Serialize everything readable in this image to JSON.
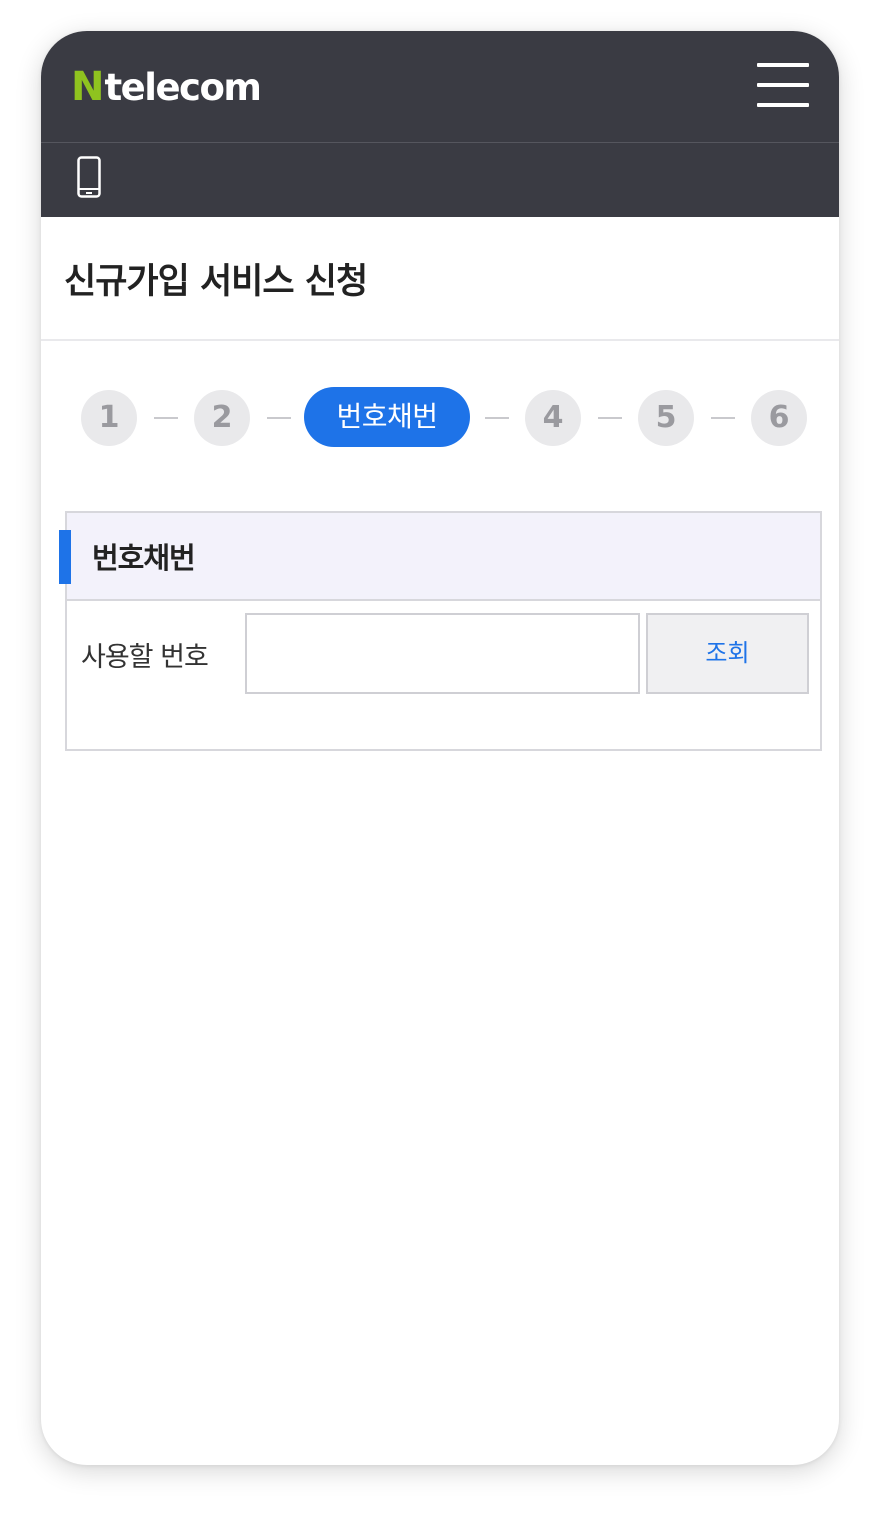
{
  "header": {
    "logo_letter": "N",
    "logo_text": "telecom",
    "menu_icon": "hamburger-menu-icon",
    "logo_color": "#8fc31f",
    "bar_color": "#3a3b43"
  },
  "subheader": {
    "icon": "mobile-phone-icon"
  },
  "page": {
    "title": "신규가입 서비스 신청"
  },
  "stepper": {
    "steps": [
      "1",
      "2",
      "번호채번",
      "4",
      "5",
      "6"
    ],
    "active_index": 2,
    "active_color": "#1e73e8"
  },
  "panel": {
    "title": "번호채번",
    "field_label": "사용할 번호",
    "input_value": "",
    "button_label": "조회"
  }
}
